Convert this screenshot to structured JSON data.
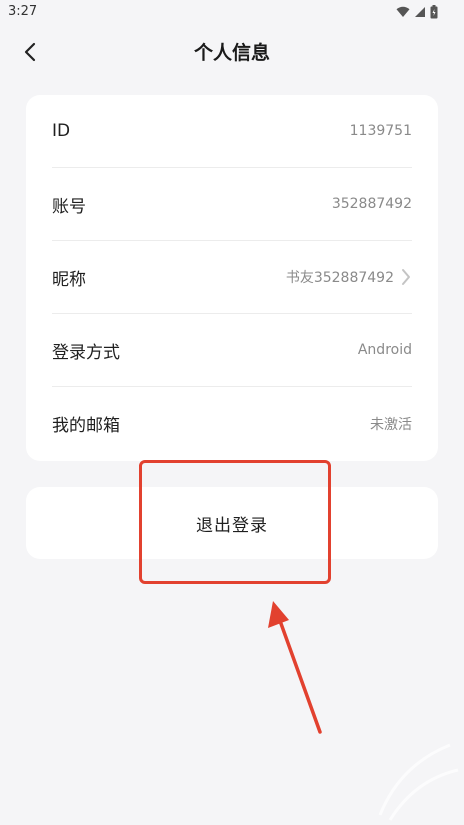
{
  "status_bar": {
    "time": "3:27"
  },
  "header": {
    "title": "个人信息"
  },
  "info_rows": [
    {
      "label": "ID",
      "value": "1139751",
      "chevron": false
    },
    {
      "label": "账号",
      "value": "352887492",
      "chevron": false
    },
    {
      "label": "昵称",
      "value": "书友352887492",
      "chevron": true
    },
    {
      "label": "登录方式",
      "value": "Android",
      "chevron": false
    },
    {
      "label": "我的邮箱",
      "value": "未激活",
      "chevron": false
    }
  ],
  "logout": {
    "label": "退出登录"
  },
  "colors": {
    "background": "#f5f5f7",
    "card": "#ffffff",
    "annotation_red": "#e2412f"
  }
}
